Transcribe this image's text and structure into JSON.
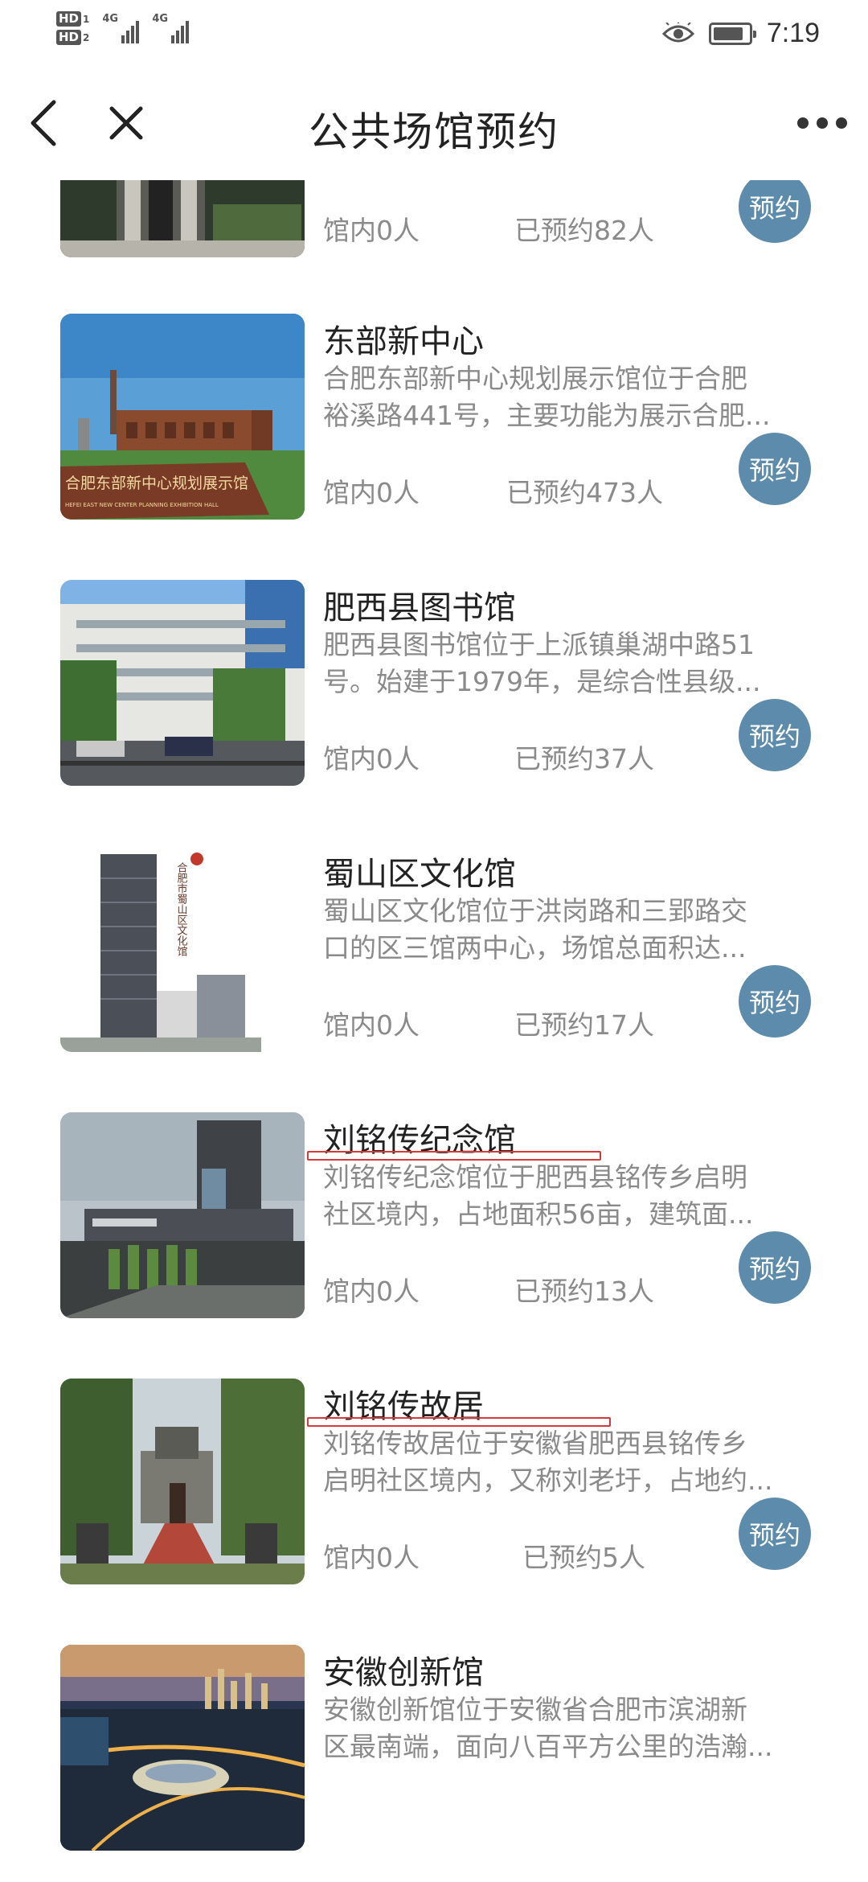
{
  "status_bar": {
    "hd1": "HD",
    "hd1_num": "1",
    "hd2": "HD",
    "hd2_num": "2",
    "sig1": "4G",
    "sig2": "4G",
    "battery_level": 0.85,
    "time": "7:19"
  },
  "nav": {
    "title": "公共场馆预约"
  },
  "book_label": "预约",
  "venues": [
    {
      "name": "",
      "desc": [
        "",
        ""
      ],
      "inside": "馆内0人",
      "booked": "已预约82人"
    },
    {
      "name": "东部新中心",
      "desc": [
        "合肥东部新中心规划展示馆位于合肥",
        "裕溪路441号，主要功能为展示合肥..."
      ],
      "inside": "馆内0人",
      "booked": "已预约473人",
      "sign_text": "合肥东部新中心规划展示馆",
      "sign_sub": "HEFEI EAST NEW CENTER PLANNING EXHIBITION HALL"
    },
    {
      "name": "肥西县图书馆",
      "desc": [
        "肥西县图书馆位于上派镇巢湖中路51",
        "号。始建于1979年，是综合性县级..."
      ],
      "inside": "馆内0人",
      "booked": "已预约37人"
    },
    {
      "name": "蜀山区文化馆",
      "desc": [
        "蜀山区文化馆位于洪岗路和三郢路交",
        "口的区三馆两中心，场馆总面积达..."
      ],
      "inside": "馆内0人",
      "booked": "已预约17人",
      "sign_text": "合肥市蜀山区文化馆"
    },
    {
      "name": "刘铭传纪念馆",
      "desc": [
        "刘铭传纪念馆位于肥西县铭传乡启明",
        "社区境内，占地面积56亩，建筑面..."
      ],
      "inside": "馆内0人",
      "booked": "已预约13人"
    },
    {
      "name": "刘铭传故居",
      "desc": [
        "刘铭传故居位于安徽省肥西县铭传乡",
        "启明社区境内，又称刘老圩，占地约..."
      ],
      "inside": "馆内0人",
      "booked": "已预约5人"
    },
    {
      "name": "安徽创新馆",
      "desc": [
        "安徽创新馆位于安徽省合肥市滨湖新",
        "区最南端，面向八百平方公里的浩瀚..."
      ],
      "inside": "",
      "booked": ""
    }
  ],
  "colors": {
    "book_button": "#5d8bab",
    "annotation": "#d43a3a",
    "secondary_text": "#8a8a8a"
  }
}
